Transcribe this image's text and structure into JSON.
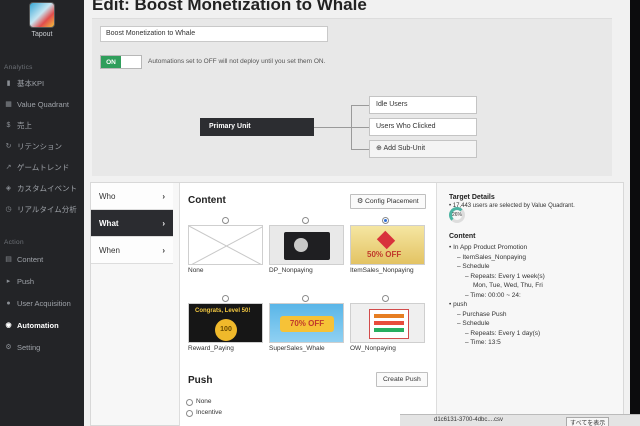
{
  "sidebar": {
    "app_name": "Tapout",
    "analytics_label": "Analytics",
    "analytics_items": [
      {
        "icon": "bar-chart-icon",
        "glyph": "▮",
        "label": "基本KPI"
      },
      {
        "icon": "grid-icon",
        "glyph": "▦",
        "label": "Value Quadrant"
      },
      {
        "icon": "currency-icon",
        "glyph": "$",
        "label": "売上"
      },
      {
        "icon": "refresh-icon",
        "glyph": "↻",
        "label": "リテンション"
      },
      {
        "icon": "trend-icon",
        "glyph": "↗",
        "label": "ゲームトレンド"
      },
      {
        "icon": "tag-icon",
        "glyph": "◈",
        "label": "カスタムイベント"
      },
      {
        "icon": "clock-icon",
        "glyph": "◷",
        "label": "リアルタイム分析"
      }
    ],
    "action_label": "Action",
    "action_items": [
      {
        "icon": "content-icon",
        "glyph": "▤",
        "label": "Content"
      },
      {
        "icon": "push-icon",
        "glyph": "▸",
        "label": "Push"
      },
      {
        "icon": "user-icon",
        "glyph": "●",
        "label": "User Acquisition"
      },
      {
        "icon": "automation-icon",
        "glyph": "◉",
        "label": "Automation"
      },
      {
        "icon": "gear-icon",
        "glyph": "⚙",
        "label": "Setting"
      }
    ]
  },
  "header": {
    "title": "Edit: Boost Monetization to Whale"
  },
  "form": {
    "name_value": "Boost Monetization to Whale",
    "toggle_label": "ON",
    "toggle_note": "Automations set to OFF will not deploy until you set them ON."
  },
  "flow": {
    "primary_unit": "Primary Unit",
    "sub_units": [
      "Idle Users",
      "Users Who Clicked"
    ],
    "add_sub_unit": "Add Sub-Unit"
  },
  "tabs": [
    "Who",
    "What",
    "When"
  ],
  "content": {
    "heading": "Content",
    "config_button": "Config Placement",
    "options": [
      {
        "label": "None",
        "selected": false
      },
      {
        "label": "DP_Nonpaying",
        "selected": false
      },
      {
        "label": "ItemSales_Nonpaying",
        "selected": true
      },
      {
        "label": "Reward_Paying",
        "selected": false
      },
      {
        "label": "SuperSales_Whale",
        "selected": false
      },
      {
        "label": "OW_Nonpaying",
        "selected": false
      }
    ],
    "thumb_texts": {
      "reward": "Congrats, Level 50!",
      "reward_amount": "100",
      "sale": "70% OFF",
      "item_sale": "50% OFF"
    }
  },
  "push": {
    "heading": "Push",
    "create_button": "Create Push",
    "options": [
      "None",
      "Incentive"
    ]
  },
  "details": {
    "target_heading": "Target Details",
    "target_line": "17,443 users are selected by Value Quadrant.",
    "target_percent": "26%",
    "content_heading": "Content",
    "lines": [
      "• In App Product Promotion",
      "– ItemSales_Nonpaying",
      "– Schedule",
      "– Repeats: Every 1 week(s)",
      "Mon, Tue, Wed, Thu, Fri",
      "– Time: 00:00 ~ 24:",
      "• push",
      "– Purchase Push",
      "– Schedule",
      "– Repeats: Every 1 day(s)",
      "– Time: 13:5"
    ]
  },
  "taskbar": {
    "file": "d1c6131-3700-4dbc....csv",
    "show_all": "すべてを表示"
  }
}
